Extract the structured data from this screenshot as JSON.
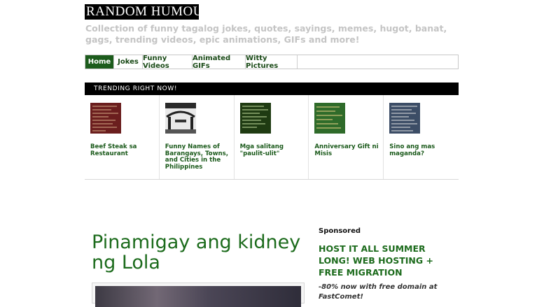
{
  "site": {
    "logo": "RANDOM HUMOURS",
    "tagline": "Collection of funny tagalog jokes, quotes, sayings, memes, hugot, banat, gags, trending videos, epic animations, GIFs and more!"
  },
  "nav": {
    "items": [
      {
        "label": "Home",
        "active": true
      },
      {
        "label": "Jokes"
      },
      {
        "label": "Funny Videos"
      },
      {
        "label": "Animated GIFs"
      },
      {
        "label": "Witty Pictures"
      }
    ]
  },
  "trending": {
    "heading": "TRENDING RIGHT NOW!",
    "items": [
      {
        "title": "Beef Steak sa Restaurant",
        "thumb_color": "#6b1e1e"
      },
      {
        "title": "Funny Names of Barangays, Towns, and Cities in the Philippines",
        "thumb_color": "#3a3a3a"
      },
      {
        "title": "Mga salitang \"paulit-ulit\"",
        "thumb_color": "#1f3b12"
      },
      {
        "title": "Anniversary Gift ni Misis",
        "thumb_color": "#2f6b2a"
      },
      {
        "title": "Sino ang mas maganda?",
        "thumb_color": "#3c4d66"
      }
    ]
  },
  "post": {
    "title": "Pinamigay ang kidney ng Lola"
  },
  "sidebar": {
    "sponsored_label": "Sponsored",
    "ad_title": "HOST IT ALL SUMMER LONG! WEB HOSTING + FREE MIGRATION",
    "ad_subtitle": "-80% now with free domain at FastComet!"
  }
}
